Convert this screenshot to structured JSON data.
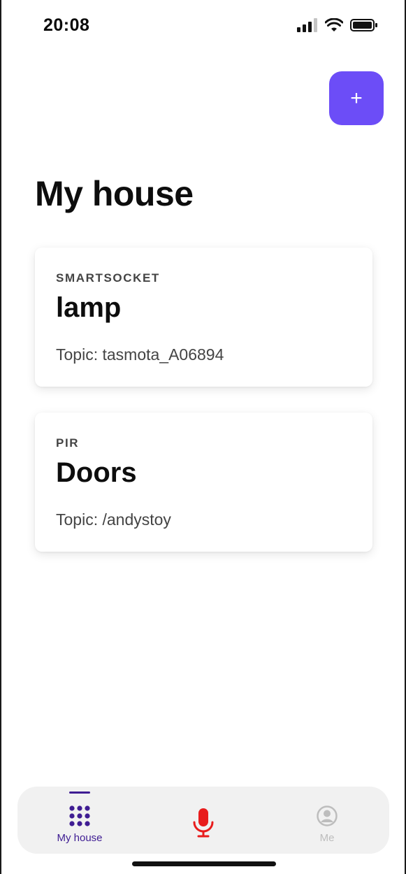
{
  "status_bar": {
    "time": "20:08"
  },
  "header": {
    "add_label": "+",
    "title": "My house"
  },
  "devices": [
    {
      "type": "SMARTSOCKET",
      "name": "lamp",
      "topic": "Topic: tasmota_A06894"
    },
    {
      "type": "PIR",
      "name": "Doors",
      "topic": "Topic: /andystoy"
    }
  ],
  "tabbar": {
    "home_label": "My house",
    "me_label": "Me",
    "active_color": "#3f1d93",
    "mic_color": "#e81c1c",
    "inactive_color": "#bdbdbd"
  },
  "icons": [
    "signal-icon",
    "wifi-icon",
    "battery-icon",
    "plus-icon",
    "grid-icon",
    "microphone-icon",
    "user-icon"
  ]
}
